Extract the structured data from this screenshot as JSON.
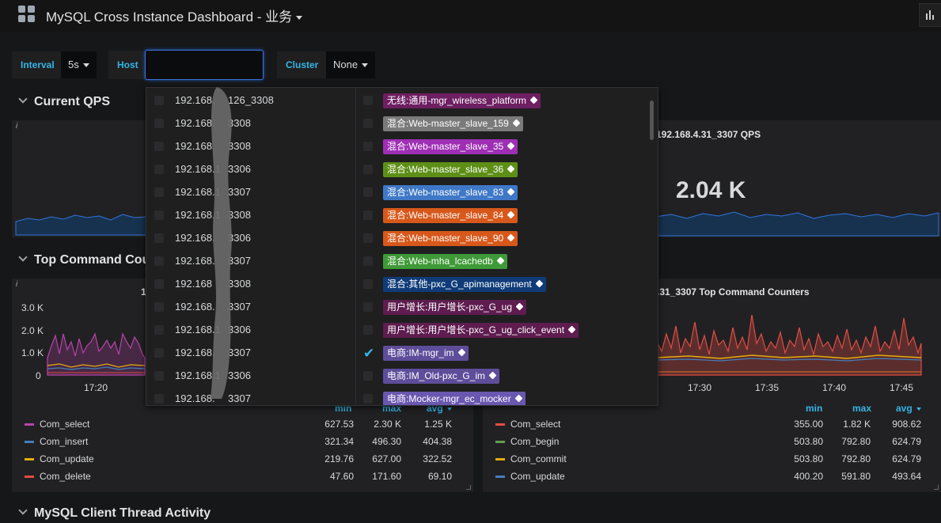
{
  "header": {
    "title": "MySQL Cross Instance Dashboard - 业务",
    "grid_icon": "grid-icon",
    "right_icon": "bar-chart-icon"
  },
  "variables": {
    "interval": {
      "label": "Interval",
      "value": "5s"
    },
    "host": {
      "label": "Host",
      "value": ""
    },
    "cluster": {
      "label": "Cluster",
      "value": "None"
    }
  },
  "rows": {
    "current_qps": "Current QPS",
    "top_command": "Top Command Cour",
    "client_thread": "MySQL Client Thread Activity"
  },
  "panels": {
    "qps_right": {
      "title": "192.168.4.31_3307 QPS",
      "value": "2.04 K"
    },
    "cmd_left": {
      "title_frag": "1",
      "yticks": [
        "3.0 K",
        "2.0 K",
        "1.0 K",
        "0"
      ],
      "xticks": [
        "17:20"
      ],
      "legend_headers": {
        "min": "min",
        "max": "max",
        "avg": "avg"
      },
      "legend": [
        {
          "name": "Com_select",
          "min": "627.53",
          "max": "2.30 K",
          "avg": "1.25 K",
          "color": "#ba43a9"
        },
        {
          "name": "Com_insert",
          "min": "321.34",
          "max": "496.30",
          "avg": "404.38",
          "color": "#447ebc"
        },
        {
          "name": "Com_update",
          "min": "219.76",
          "max": "627.00",
          "avg": "322.52",
          "color": "#e5ac0e"
        },
        {
          "name": "Com_delete",
          "min": "47.60",
          "max": "171.60",
          "avg": "69.10",
          "color": "#e24d42"
        }
      ]
    },
    "cmd_right": {
      "title": ".31_3307 Top Command Counters",
      "xticks": [
        "17:30",
        "17:35",
        "17:40",
        "17:45"
      ],
      "legend_headers": {
        "min": "min",
        "max": "max",
        "avg": "avg"
      },
      "legend": [
        {
          "name": "Com_select",
          "min": "355.00",
          "max": "1.82 K",
          "avg": "908.62",
          "color": "#e24d42"
        },
        {
          "name": "Com_begin",
          "min": "503.80",
          "max": "792.80",
          "avg": "624.79",
          "color": "#629e51"
        },
        {
          "name": "Com_commit",
          "min": "503.80",
          "max": "792.80",
          "avg": "624.79",
          "color": "#e5ac0e"
        },
        {
          "name": "Com_update",
          "min": "400.20",
          "max": "591.80",
          "avg": "493.64",
          "color": "#447ebc"
        }
      ]
    }
  },
  "host_options": [
    {
      "prefix": "192.168.",
      "suffix": "126_3308"
    },
    {
      "prefix": "192.168.",
      "suffix": "3308"
    },
    {
      "prefix": "192.168.",
      "suffix": "3308"
    },
    {
      "prefix": "192.168.1",
      "suffix": "3306"
    },
    {
      "prefix": "192.168.1",
      "suffix": "3307"
    },
    {
      "prefix": "192.168.1",
      "suffix": "3308"
    },
    {
      "prefix": "192.168.",
      "suffix": "3306"
    },
    {
      "prefix": "192.168.",
      "suffix": "3307"
    },
    {
      "prefix": "192.168",
      "suffix": "3308"
    },
    {
      "prefix": "192.168.",
      "suffix": "3307"
    },
    {
      "prefix": "192.168.1",
      "suffix": "3306"
    },
    {
      "prefix": "192.168.",
      "suffix": "3307"
    },
    {
      "prefix": "192.168.1",
      "suffix": "3306"
    },
    {
      "prefix": "192.168.",
      "suffix": "3307"
    }
  ],
  "cluster_options": [
    {
      "label": "无线:通用-mgr_wireless_platform",
      "color": "#6d1f62",
      "checked": false
    },
    {
      "label": "混合:Web-master_slave_159",
      "color": "#7a7a7a",
      "checked": false
    },
    {
      "label": "混合:Web-master_slave_35",
      "color": "#9e2fb5",
      "checked": false
    },
    {
      "label": "混合:Web-master_slave_36",
      "color": "#5d8f16",
      "checked": false
    },
    {
      "label": "混合:Web-master_slave_83",
      "color": "#3f78c7",
      "checked": false
    },
    {
      "label": "混合:Web-master_slave_84",
      "color": "#d7581b",
      "checked": false
    },
    {
      "label": "混合:Web-master_slave_90",
      "color": "#d7581b",
      "checked": false
    },
    {
      "label": "混合:Web-mha_lcachedb",
      "color": "#3f9a38",
      "checked": false
    },
    {
      "label": "混合:其他-pxc_G_apimanagement",
      "color": "#0f3c78",
      "checked": false
    },
    {
      "label": "用户增长:用户增长-pxc_G_ug",
      "color": "#5e1c4f",
      "checked": false
    },
    {
      "label": "用户增长:用户增长-pxc_G_ug_click_event",
      "color": "#5e1c4f",
      "checked": false
    },
    {
      "label": "电商:IM-mgr_im",
      "color": "#5e4d9a",
      "checked": true
    },
    {
      "label": "电商:IM_Old-pxc_G_im",
      "color": "#5e4d9a",
      "checked": false
    },
    {
      "label": "电商:Mocker-mgr_ec_mocker",
      "color": "#6a57b0",
      "checked": false
    }
  ],
  "icons": {
    "tag": "tag-icon",
    "check": "check-icon",
    "info": "info-icon"
  }
}
